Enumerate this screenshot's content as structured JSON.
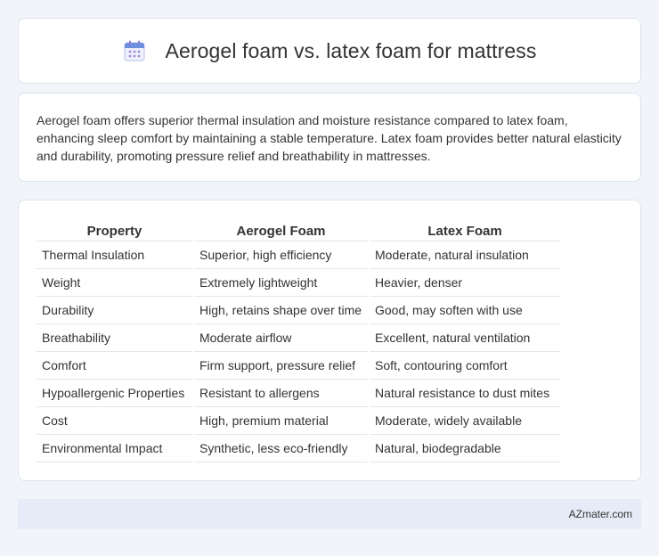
{
  "header": {
    "icon": "calendar-icon",
    "title": "Aerogel foam vs. latex foam for mattress"
  },
  "summary": {
    "text": "Aerogel foam offers superior thermal insulation and moisture resistance compared to latex foam, enhancing sleep comfort by maintaining a stable temperature. Latex foam provides better natural elasticity and durability, promoting pressure relief and breathability in mattresses."
  },
  "table": {
    "headers": [
      "Property",
      "Aerogel Foam",
      "Latex Foam"
    ],
    "rows": [
      [
        "Thermal Insulation",
        "Superior, high efficiency",
        "Moderate, natural insulation"
      ],
      [
        "Weight",
        "Extremely lightweight",
        "Heavier, denser"
      ],
      [
        "Durability",
        "High, retains shape over time",
        "Good, may soften with use"
      ],
      [
        "Breathability",
        "Moderate airflow",
        "Excellent, natural ventilation"
      ],
      [
        "Comfort",
        "Firm support, pressure relief",
        "Soft, contouring comfort"
      ],
      [
        "Hypoallergenic Properties",
        "Resistant to allergens",
        "Natural resistance to dust mites"
      ],
      [
        "Cost",
        "High, premium material",
        "Moderate, widely available"
      ],
      [
        "Environmental Impact",
        "Synthetic, less eco-friendly",
        "Natural, biodegradable"
      ]
    ]
  },
  "footer": {
    "text": "AZmater.com"
  },
  "colors": {
    "background": "#f1f4f9",
    "card": "#ffffff",
    "footer": "#e6ecf7",
    "icon_accent": "#7b83d6"
  }
}
